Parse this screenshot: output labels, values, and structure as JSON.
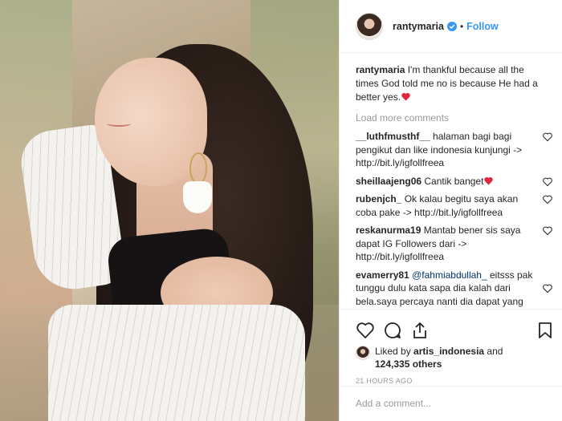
{
  "post": {
    "username": "rantymaria",
    "dot": "•",
    "follow_label": "Follow",
    "caption_user": "rantymaria",
    "caption_text": "I'm thankful because all the times God told me no is because He had a better yes.",
    "caption_emoji": "red-heart-icon",
    "load_more": "Load more comments"
  },
  "comments": [
    {
      "user": "__luthfmusthf__",
      "text": "halaman bagi bagi pengikut dan like indonesia kunjungi -> http://bit.ly/igfollfreea",
      "liked": false
    },
    {
      "user": "sheillaajeng06",
      "text": "Cantik banget",
      "emoji": "red-heart-icon",
      "liked": false
    },
    {
      "user": "rubenjch_",
      "text": "Ok kalau begitu saya akan coba pake -> http://bit.ly/igfollfreea",
      "liked": false
    },
    {
      "user": "reskanurma19",
      "text": "Mantab bener sis saya dapat IG Followers dari -> http://bit.ly/igfollfreea",
      "liked": false
    },
    {
      "user": "evamerry81",
      "mention": "@fahmiabdullah_",
      "text": "eitsss pak tunggu dulu kata sapa dia kalah dari bela.saya percaya nanti dia dapat yang lebih baik dari segalanya dari",
      "liked": false
    }
  ],
  "actions": {
    "liked_prefix": "Liked by",
    "liked_user": "artis_indonesia",
    "liked_and": "and",
    "liked_count": "124,335 others",
    "timestamp": "21 hours ago"
  },
  "add_comment": {
    "placeholder": "Add a comment..."
  },
  "colors": {
    "accent": "#3897f0",
    "heart": "#ed4956",
    "muted": "#999999",
    "text": "#262626"
  },
  "icons": [
    "heart-icon",
    "comment-icon",
    "share-icon",
    "bookmark-icon",
    "verified-badge-icon"
  ]
}
